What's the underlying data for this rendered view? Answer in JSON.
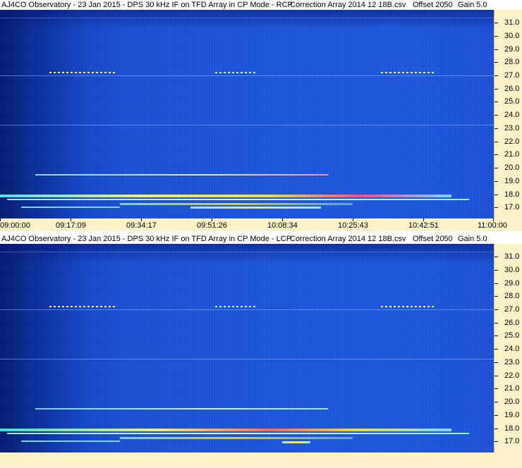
{
  "panels": [
    {
      "id": "rcp",
      "title_main": "AJ4CO Observatory - 23 Jan 2015 - DPS 30 kHz IF on TFD Array in CP Mode - RCP",
      "correction": "Correction Array 2014 12 18B.csv",
      "offset": "Offset 2050",
      "gain": "Gain 5.0"
    },
    {
      "id": "lcp",
      "title_main": "AJ4CO Observatory - 23 Jan 2015 - DPS 30 kHz IF on TFD Array in CP Mode - LCP",
      "correction": "Correction Array 2014 12 18B.csv",
      "offset": "Offset 2050",
      "gain": "Gain 5.0"
    }
  ],
  "x_axis_labels": [
    "09:00:00",
    "09:17:09",
    "09:34:17",
    "09:51:26",
    "10:08:34",
    "10:25:43",
    "10:42:51",
    "11:00:00"
  ],
  "y_axis_labels": [
    "31.0",
    "30.0",
    "29.0",
    "28.0",
    "27.0",
    "26.0",
    "25.0",
    "24.0",
    "23.0",
    "22.0",
    "21.0",
    "20.0",
    "19.0",
    "18.0",
    "17.0"
  ],
  "colors": {
    "background_dark": "#0b2f9a",
    "background_main": "#1c58e0",
    "axis_panel": "#fdf2c8",
    "signal_hot": "#e8e040",
    "signal_warm": "#ff4a7a"
  }
}
